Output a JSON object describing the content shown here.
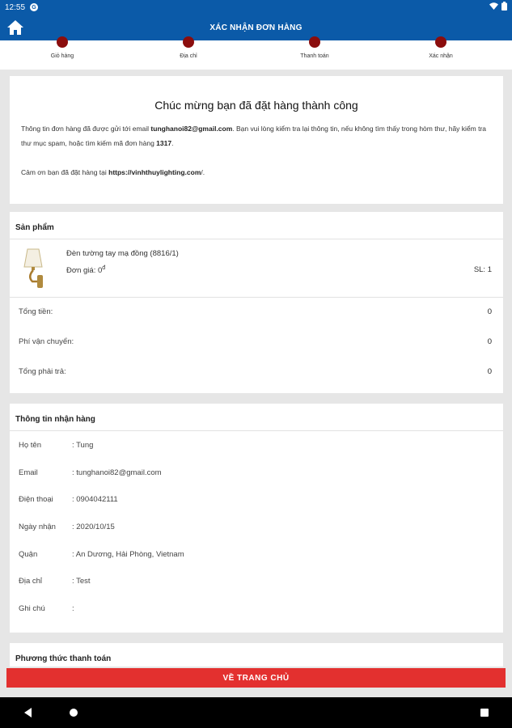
{
  "status": {
    "time": "12:55",
    "app_glyph": "G"
  },
  "header": {
    "title": "XÁC NHẬN ĐƠN HÀNG",
    "accent": "#0b5aa8"
  },
  "steps": [
    {
      "label": "Giỏ hàng"
    },
    {
      "label": "Địa chỉ"
    },
    {
      "label": "Thanh toán"
    },
    {
      "label": "Xác nhận"
    }
  ],
  "success": {
    "heading": "Chúc mừng bạn đã đặt hàng thành công",
    "line1_prefix": "Thông tin đơn hàng đã được gửi tới email ",
    "email": "tunghanoi82@gmail.com",
    "line1_middle": ". Bạn vui lòng kiểm tra lại thông tin, nếu không tìm thấy trong hòm thư, hãy kiểm tra thư mục spam, hoặc tìm kiếm mã đơn hàng ",
    "order_id": "1317",
    "line1_suffix": ".",
    "line2_prefix": "Cảm ơn bạn đã đặt hàng tại ",
    "site": "https://vinhthuylighting.com",
    "line2_suffix": "/."
  },
  "products": {
    "title": "Sản phẩm",
    "item": {
      "name": "Đèn tường tay mạ đồng (8816/1)",
      "price_label": "Đơn giá: ",
      "price": "0",
      "currency": "đ",
      "qty": "SL: 1"
    },
    "totals": [
      {
        "label": "Tổng tiền:",
        "value": "0"
      },
      {
        "label": "Phí vận chuyển:",
        "value": "0"
      },
      {
        "label": "Tổng phải trả:",
        "value": "0"
      }
    ]
  },
  "receiver": {
    "title": "Thông tin nhận hàng",
    "rows": [
      {
        "label": "Họ tên",
        "value": ": Tung"
      },
      {
        "label": "Email",
        "value": ": tunghanoi82@gmail.com"
      },
      {
        "label": "Điện thoại",
        "value": ": 0904042111"
      },
      {
        "label": "Ngày nhận",
        "value": ": 2020/10/15"
      },
      {
        "label": "Quận",
        "value": ": An Dương, Hải Phòng, Vietnam"
      },
      {
        "label": "Địa chỉ",
        "value": ": Test"
      },
      {
        "label": "Ghi chú",
        "value": ":"
      }
    ]
  },
  "payment": {
    "title": "Phương thức thanh toán"
  },
  "cta": {
    "label": "VỀ TRANG CHỦ",
    "color": "#e3302f"
  }
}
